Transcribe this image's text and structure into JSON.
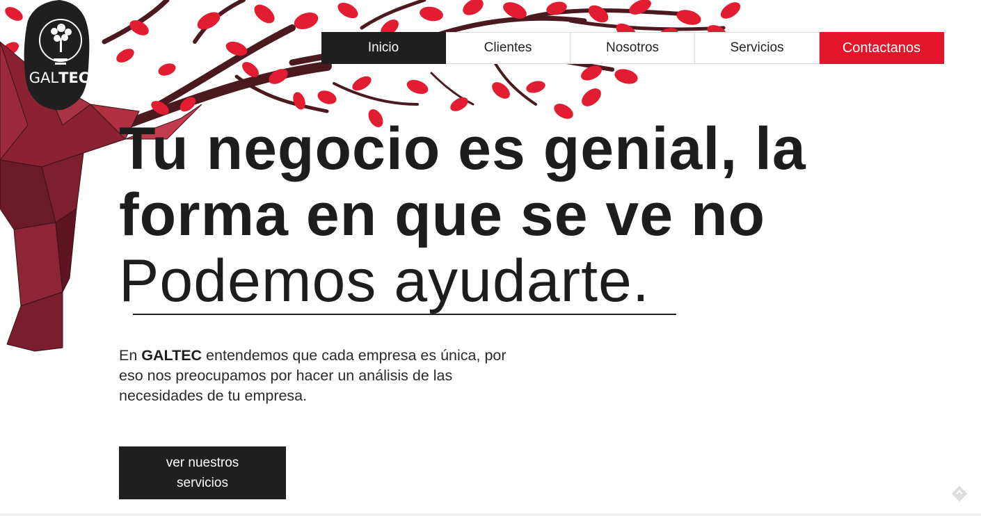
{
  "logo": {
    "text_pre": "GAL",
    "text_post": "TEC"
  },
  "nav": {
    "items": [
      {
        "label": "Inicio"
      },
      {
        "label": "Clientes"
      },
      {
        "label": "Nosotros"
      },
      {
        "label": "Servicios"
      },
      {
        "label": "Contactanos"
      }
    ]
  },
  "hero": {
    "headline_line1": "Tu negocio es genial, la",
    "headline_line2": "forma en que se ve no",
    "headline_line3": "Podemos ayudarte",
    "headline_period": ".",
    "intro_pre": "En ",
    "intro_brand": "GALTEC",
    "intro_post": " entendemos que cada empresa es única, por eso nos preocupamos por hacer un análisis de las necesidades de tu empresa.",
    "cta_label": "ver nuestros servicios"
  },
  "colors": {
    "accent_red": "#e3162b",
    "dark": "#1f1f1f",
    "tree_trunk": "#7a1d2c"
  }
}
